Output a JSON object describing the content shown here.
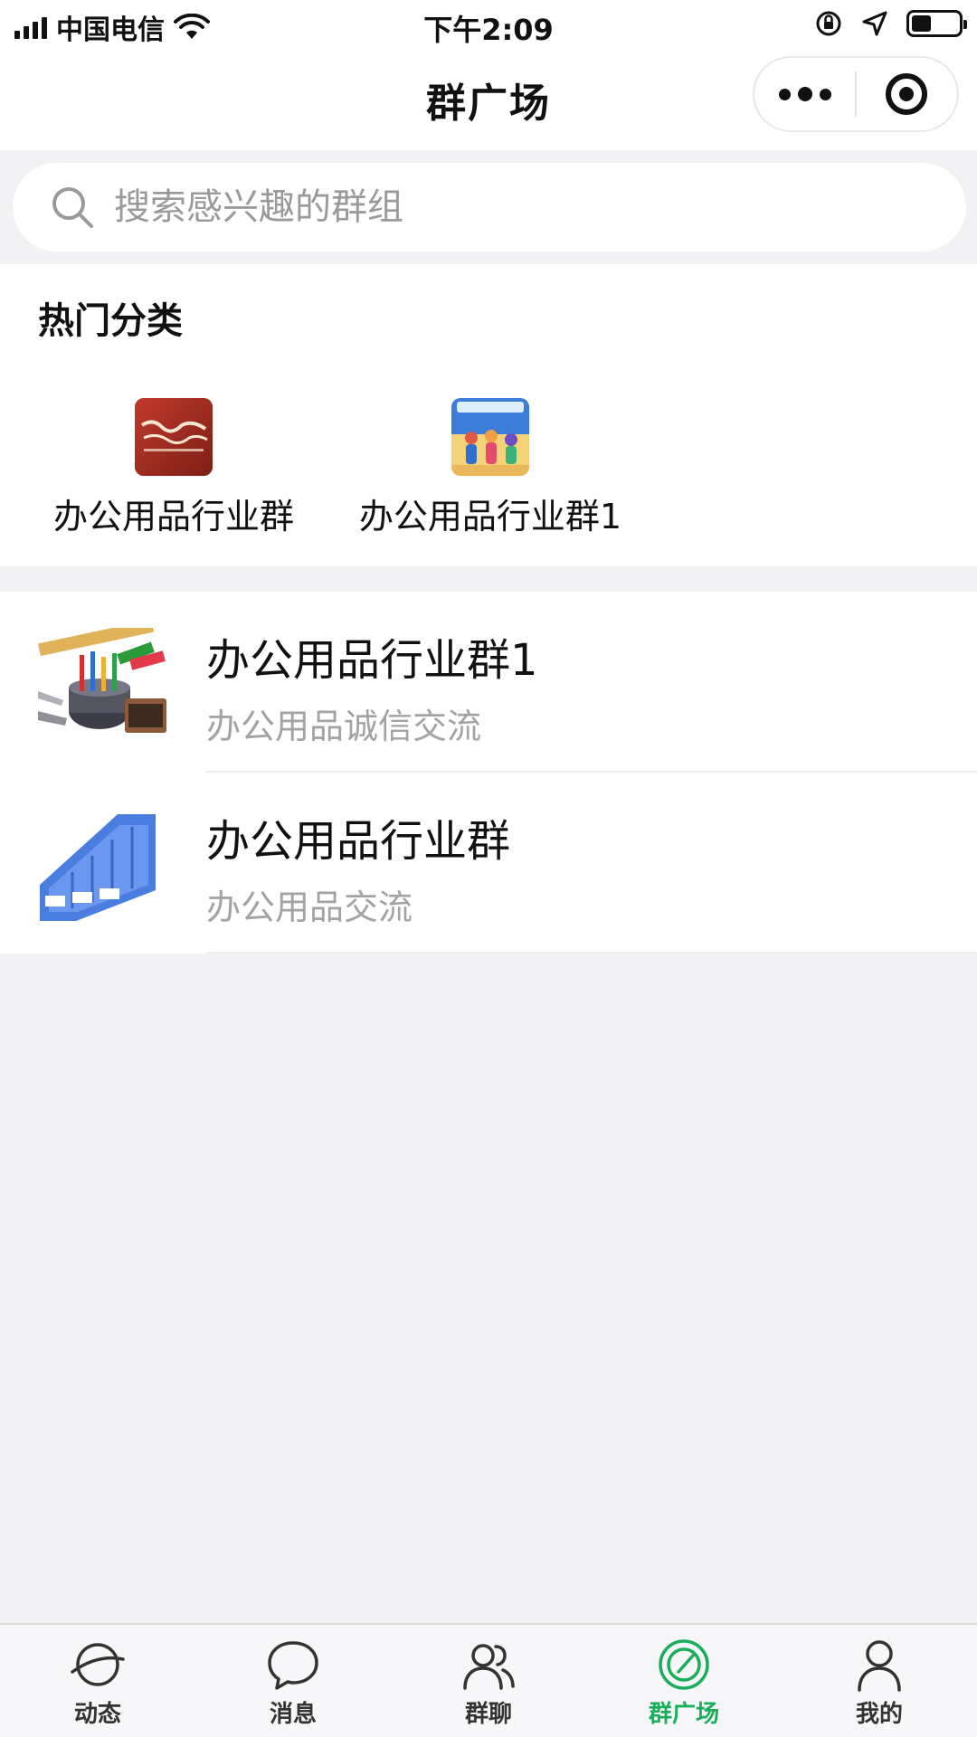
{
  "status_bar": {
    "carrier": "中国电信",
    "time": "下午2:09"
  },
  "nav": {
    "title": "群广场"
  },
  "search": {
    "placeholder": "搜索感兴趣的群组"
  },
  "hot": {
    "title": "热门分类",
    "items": [
      {
        "label": "办公用品行业群"
      },
      {
        "label": "办公用品行业群1"
      }
    ]
  },
  "groups": [
    {
      "name": "办公用品行业群1",
      "desc": "办公用品诚信交流"
    },
    {
      "name": "办公用品行业群",
      "desc": "办公用品交流"
    }
  ],
  "tabs": [
    {
      "label": "动态",
      "icon": "planet-icon"
    },
    {
      "label": "消息",
      "icon": "chat-bubble-icon"
    },
    {
      "label": "群聊",
      "icon": "group-people-icon"
    },
    {
      "label": "群广场",
      "icon": "compass-icon",
      "active": true
    },
    {
      "label": "我的",
      "icon": "person-icon"
    }
  ],
  "colors": {
    "accent": "#1aad5a",
    "background": "#f2f2f5"
  }
}
